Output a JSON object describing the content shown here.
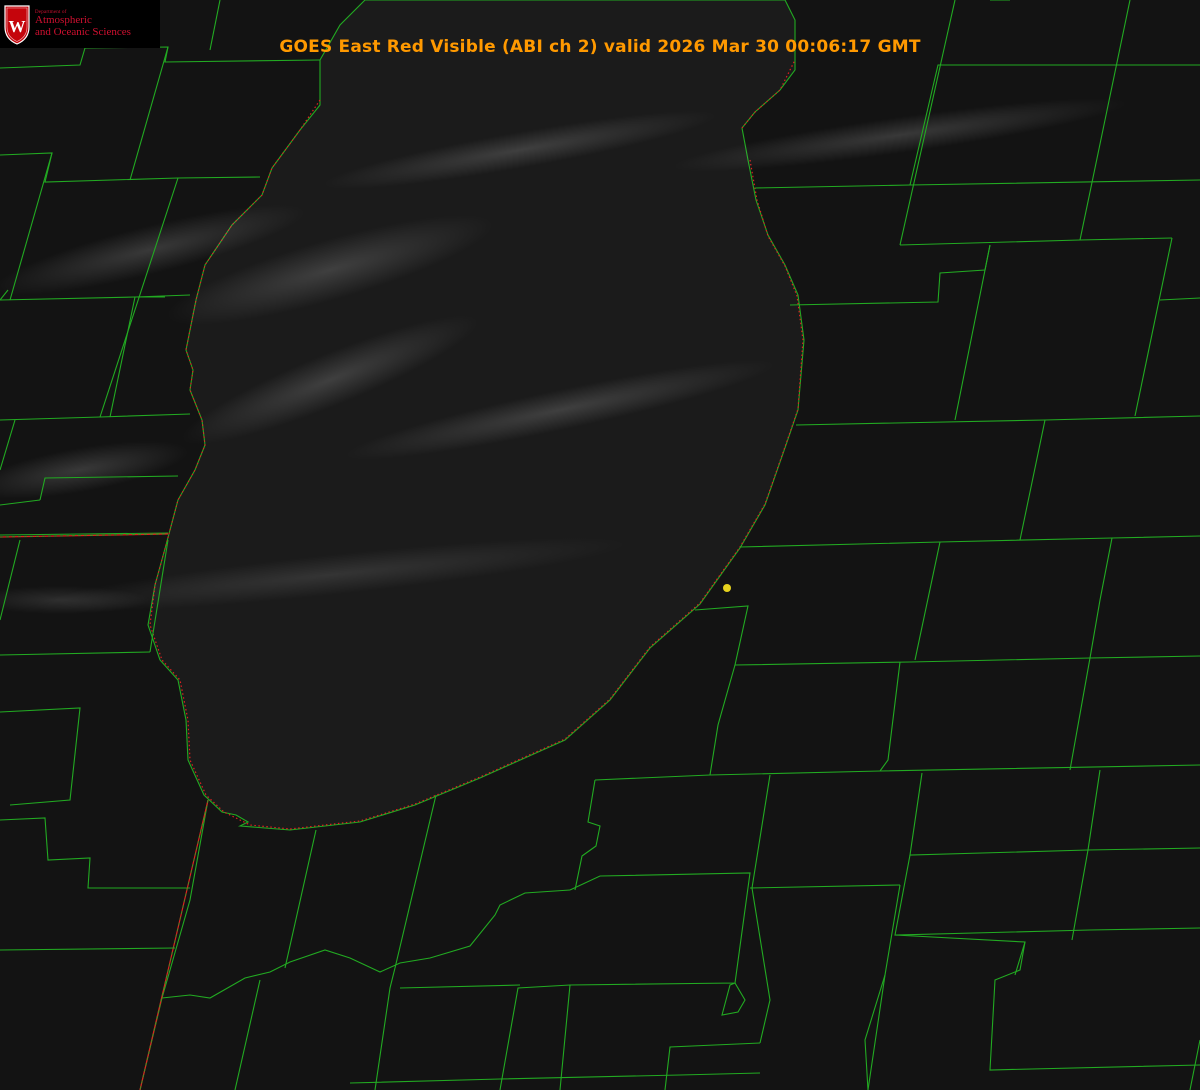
{
  "title": "GOES East Red Visible (ABI ch 2) valid 2026 Mar 30 00:06:17 GMT",
  "logo": {
    "initial": "W",
    "dept": "Department of",
    "line1": "Atmospheric",
    "line2": "and Oceanic Sciences"
  },
  "colors": {
    "background": "#131313",
    "lake_fill": "#1b1b1b",
    "borders": "#22aa22",
    "shoreline_hires": "#e02020",
    "title": "#ff9900",
    "marker": "#e6d21e",
    "logo_red": "#c5050c"
  },
  "layers": [
    "county-borders",
    "state-borders",
    "lake-shoreline",
    "station-marker"
  ],
  "marker_icon": "yellow-dot-station-icon"
}
